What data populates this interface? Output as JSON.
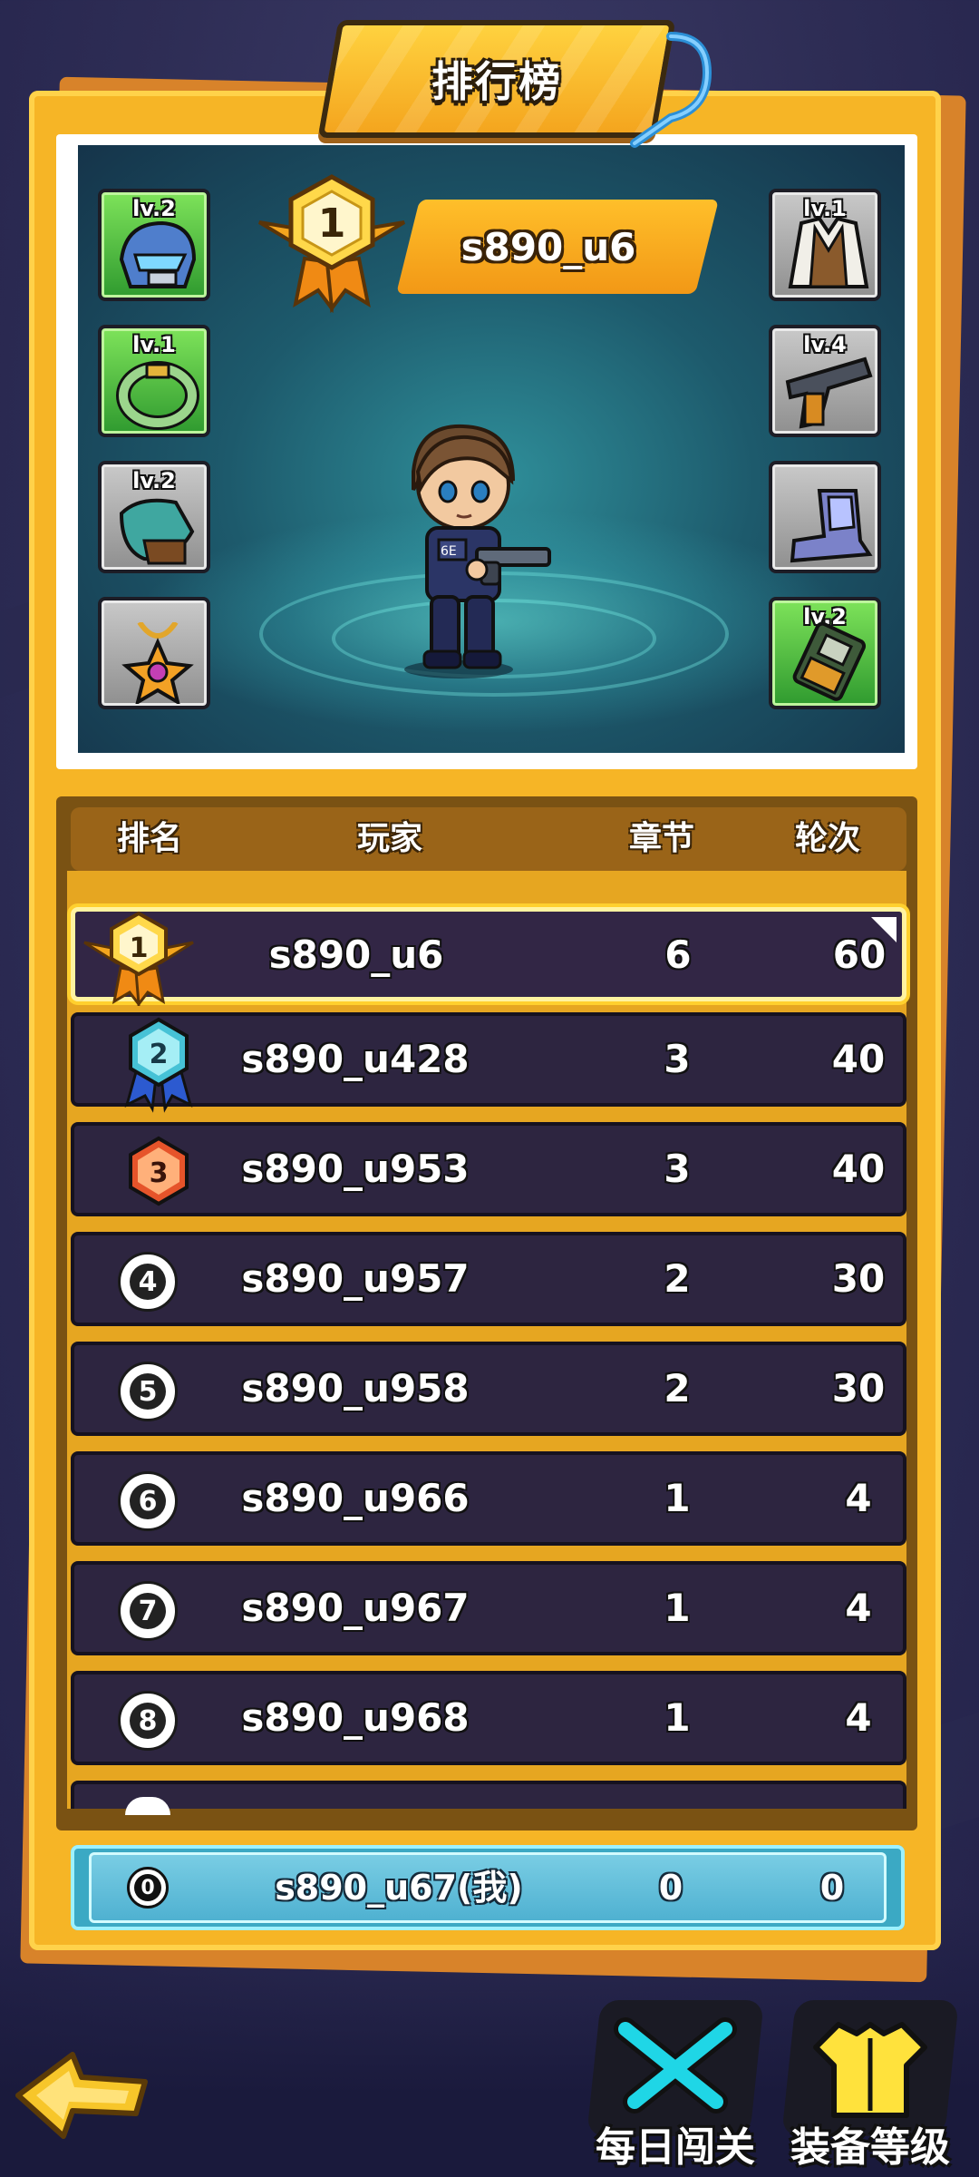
{
  "title": "排行榜",
  "top_player": {
    "rank": "1",
    "name": "s890_u6"
  },
  "equipment": {
    "left": [
      {
        "level": "lv.2",
        "icon": "helmet-icon",
        "rarity": "green"
      },
      {
        "level": "lv.1",
        "icon": "ring-icon",
        "rarity": "green"
      },
      {
        "level": "lv.2",
        "icon": "gloves-icon",
        "rarity": "gray"
      },
      {
        "level": "",
        "icon": "amulet-icon",
        "rarity": "gray"
      }
    ],
    "right": [
      {
        "level": "lv.1",
        "icon": "vest-icon",
        "rarity": "gray"
      },
      {
        "level": "lv.4",
        "icon": "pistol-icon",
        "rarity": "gray"
      },
      {
        "level": "",
        "icon": "boots-icon",
        "rarity": "gray"
      },
      {
        "level": "lv.2",
        "icon": "chip-icon",
        "rarity": "green"
      }
    ]
  },
  "table": {
    "headers": {
      "rank": "排名",
      "player": "玩家",
      "chapter": "章节",
      "round": "轮次"
    },
    "rows": [
      {
        "rank": "1",
        "name": "s890_u6",
        "chapter": "6",
        "round": "60"
      },
      {
        "rank": "2",
        "name": "s890_u428",
        "chapter": "3",
        "round": "40"
      },
      {
        "rank": "3",
        "name": "s890_u953",
        "chapter": "3",
        "round": "40"
      },
      {
        "rank": "4",
        "name": "s890_u957",
        "chapter": "2",
        "round": "30"
      },
      {
        "rank": "5",
        "name": "s890_u958",
        "chapter": "2",
        "round": "30"
      },
      {
        "rank": "6",
        "name": "s890_u966",
        "chapter": "1",
        "round": "4"
      },
      {
        "rank": "7",
        "name": "s890_u967",
        "chapter": "1",
        "round": "4"
      },
      {
        "rank": "8",
        "name": "s890_u968",
        "chapter": "1",
        "round": "4"
      }
    ]
  },
  "my_row": {
    "rank": "0",
    "name": "s890_u67(我)",
    "chapter": "0",
    "round": "0"
  },
  "nav": {
    "daily": "每日闯关",
    "equip_level": "装备等级"
  },
  "colors": {
    "panel": "#f6b526",
    "row_bg": "#2d2540",
    "my_row": "#4fb1d1",
    "accent": "#ffd02e"
  }
}
